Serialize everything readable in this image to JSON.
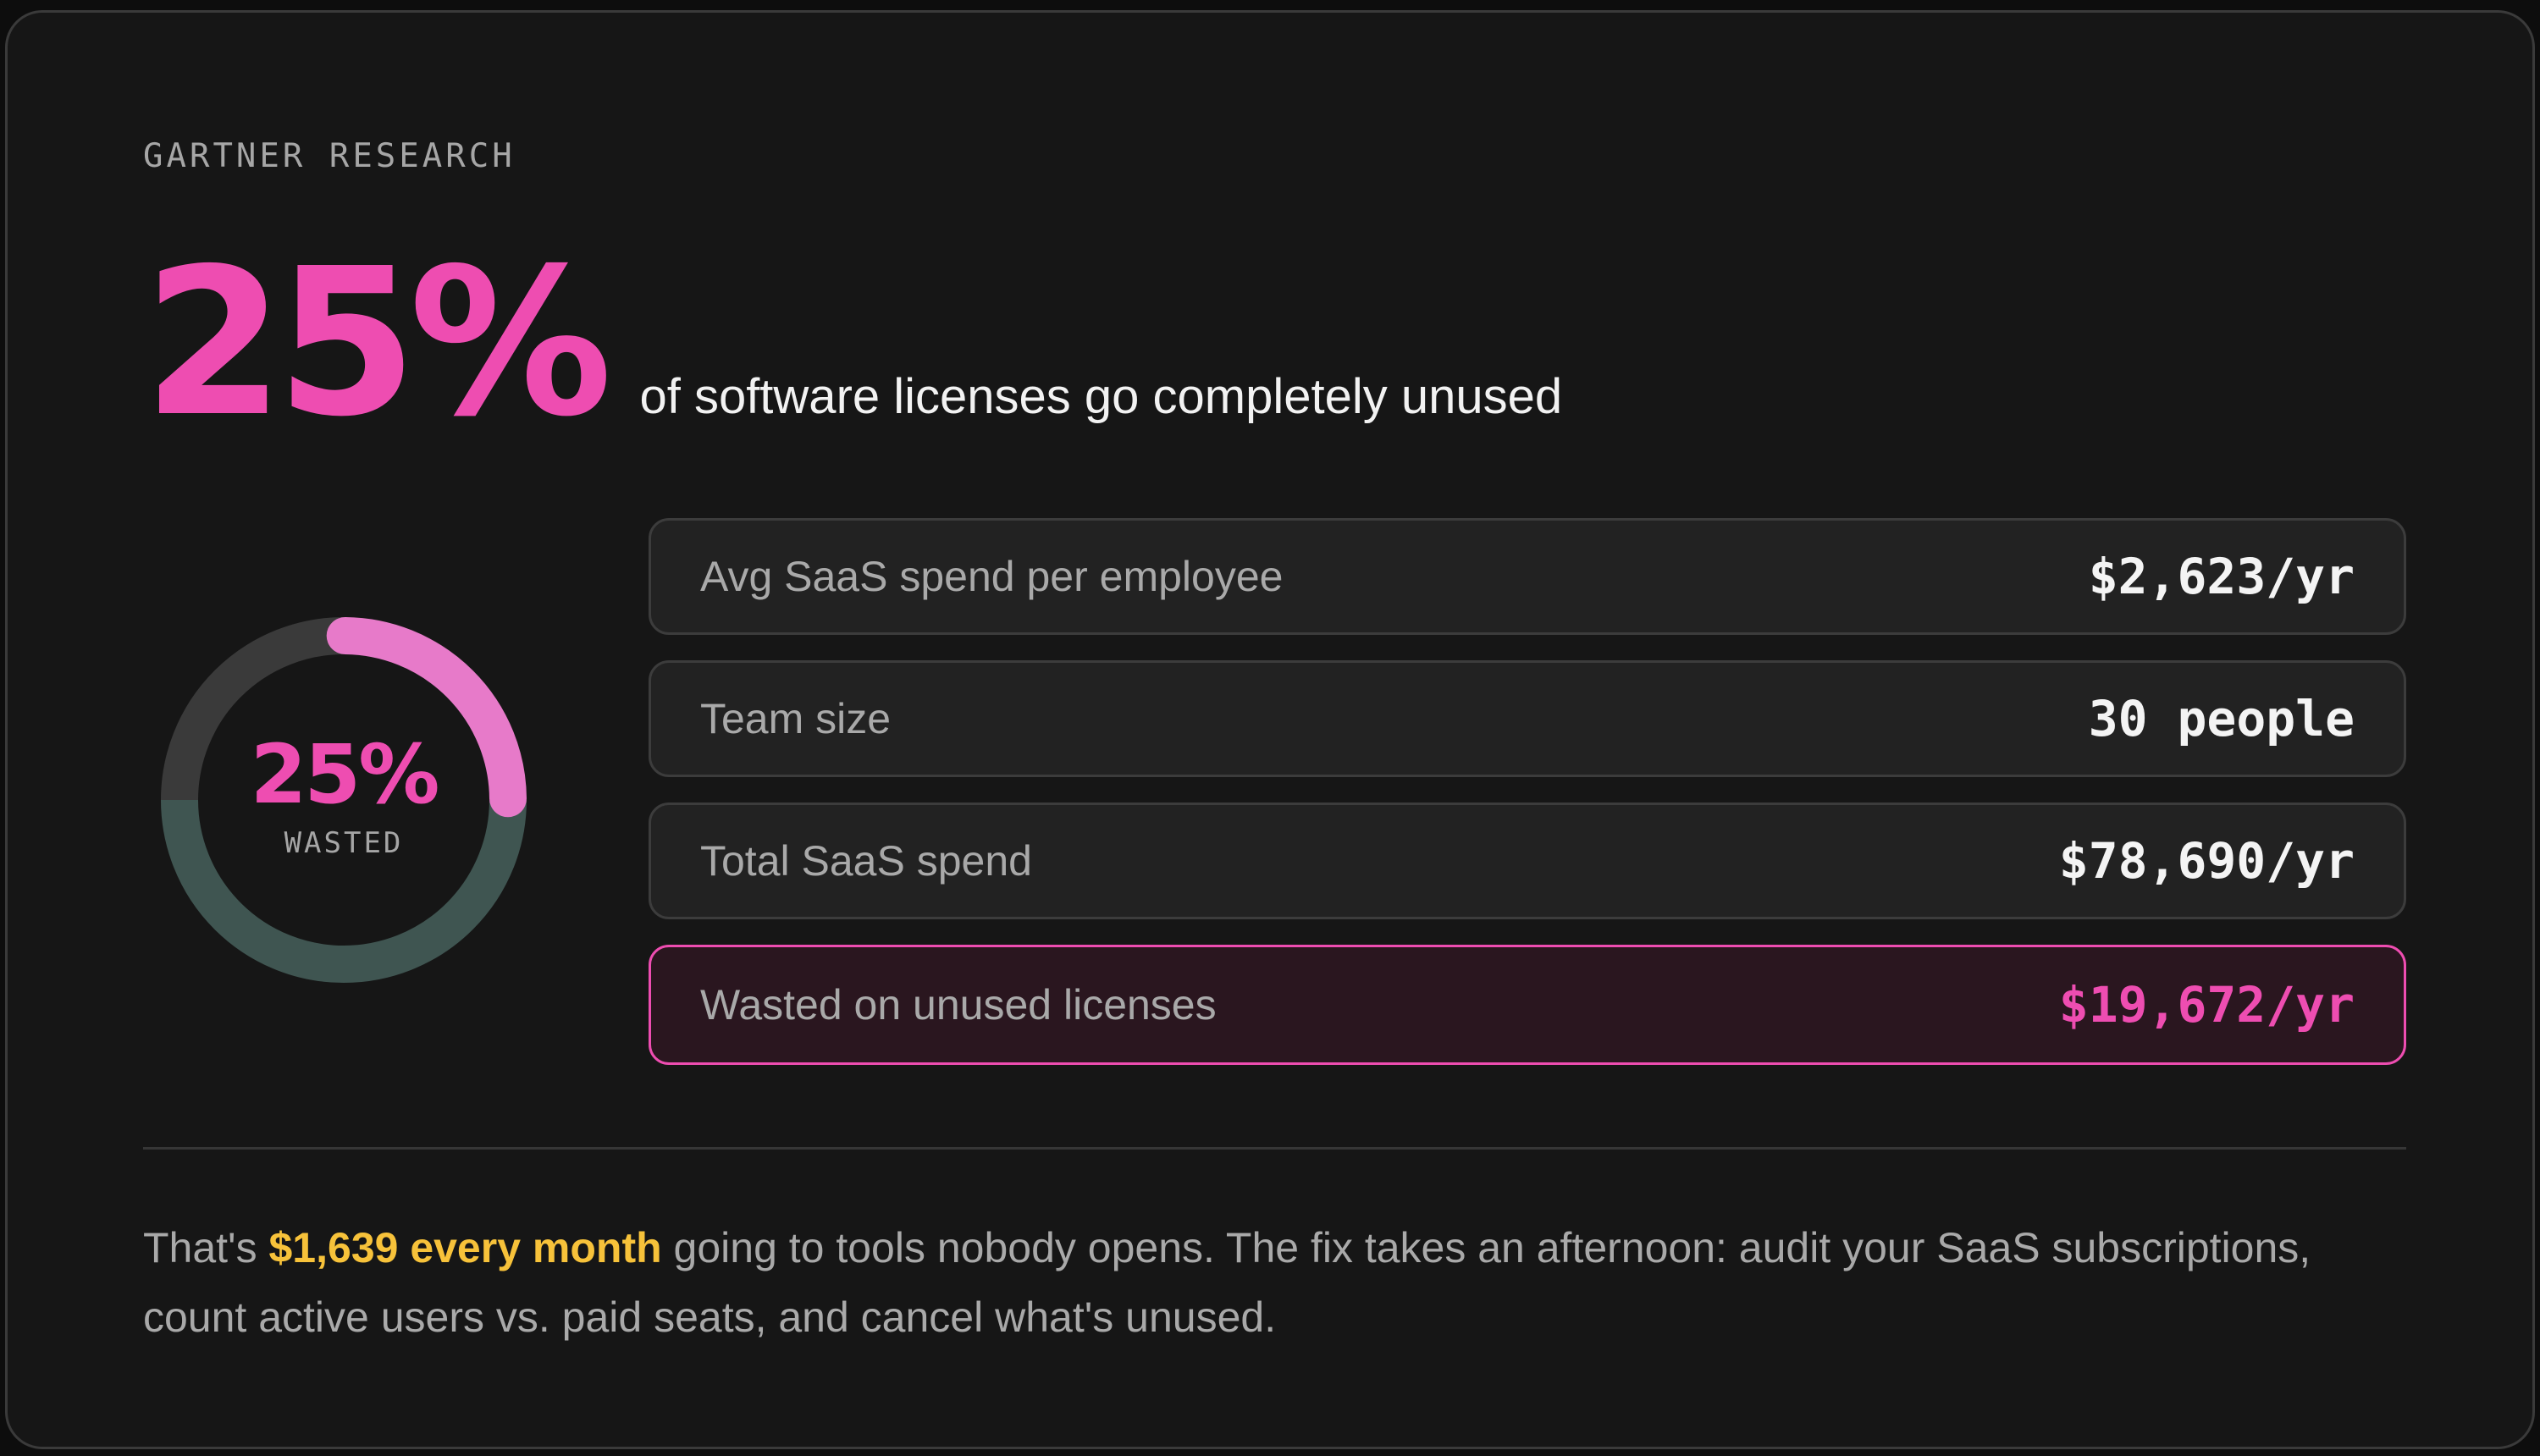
{
  "eyebrow": "GARTNER RESEARCH",
  "hero": {
    "value": "25%",
    "text": "of software licenses go completely unused"
  },
  "donut": {
    "label": "25%",
    "sublabel": "WASTED",
    "fraction": 0.25
  },
  "rows": [
    {
      "label": "Avg SaaS spend per employee",
      "value": "$2,623/yr"
    },
    {
      "label": "Team size",
      "value": "30 people"
    },
    {
      "label": "Total SaaS spend",
      "value": "$78,690/yr"
    },
    {
      "label": "Wasted on unused licenses",
      "value": "$19,672/yr"
    }
  ],
  "footnote": {
    "prefix": "That's ",
    "highlight": "$1,639 every month",
    "suffix": " going to tools nobody opens. The fix takes an afternoon: audit your SaaS subscriptions, count active users vs. paid seats, and cancel what's unused."
  },
  "colors": {
    "accent": "#ee4db1",
    "accent_light": "#e77ac9",
    "highlight": "#f7c23a",
    "track_used": "#3f5551",
    "track_top": "#3a3a3a"
  }
}
